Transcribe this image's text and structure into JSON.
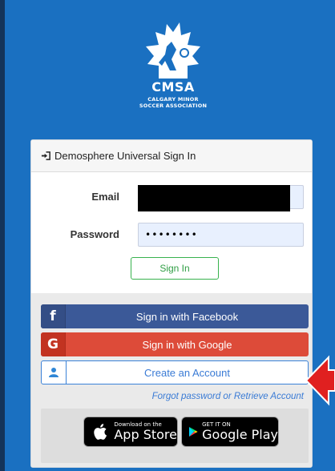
{
  "logo": {
    "name": "CMSA",
    "line1": "CALGARY MINOR",
    "line2": "SOCCER ASSOCIATION"
  },
  "card": {
    "header": "Demosphere Universal Sign In"
  },
  "form": {
    "email_label": "Email",
    "email_value": "",
    "password_label": "Password",
    "password_value": "••••••••",
    "signin_label": "Sign In"
  },
  "social": {
    "facebook_label": "Sign in with Facebook",
    "google_label": "Sign in with Google",
    "create_label": "Create an Account",
    "forgot_label": "Forgot password or Retrieve Account"
  },
  "stores": {
    "appstore_small": "Download on the",
    "appstore_big": "App Store",
    "googleplay_small": "GET IT ON",
    "googleplay_big": "Google Play"
  },
  "colors": {
    "background": "#1a70c1",
    "facebook": "#3b5998",
    "google": "#dd4b39",
    "signin_green": "#37b24d",
    "link_blue": "#3a7bd5",
    "arrow_red": "#e02020"
  },
  "icons": {
    "header": "sign-in-icon",
    "facebook": "facebook-icon",
    "google": "google-icon",
    "create": "user-icon",
    "apple": "apple-icon",
    "play": "play-store-icon"
  }
}
